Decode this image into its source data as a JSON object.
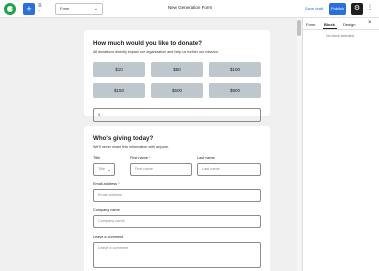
{
  "toolbar": {
    "add_symbol": "+",
    "form_select_value": "Form",
    "form_title": "New Generation Form",
    "save_draft": "Save draft",
    "publish": "Publish",
    "settings_symbol": "⚙",
    "more_symbol": "⋮"
  },
  "donate": {
    "title": "How much would you like to donate?",
    "subtitle": "All donations directly impact our organization and help us further our mission.",
    "amounts": [
      "$10",
      "$50",
      "$100",
      "$150",
      "$500",
      "$900"
    ],
    "custom_placeholder": "$"
  },
  "giver": {
    "title": "Who's giving today?",
    "subtitle": "We'll never share this information with anyone.",
    "title_label": "Title",
    "title_value": "Title",
    "first_name_label": "First name",
    "first_name_placeholder": "First name",
    "last_name_label": "Last name",
    "last_name_placeholder": "Last name",
    "email_label": "Email address",
    "email_placeholder": "Email address",
    "company_label": "Company name",
    "company_placeholder": "Company name",
    "comment_label": "Leave a comment",
    "comment_placeholder": "Leave a comment",
    "required_mark": "*"
  },
  "sidebar": {
    "tabs": [
      "Form",
      "Block",
      "Design"
    ],
    "active_tab": "Block",
    "close_symbol": "×",
    "empty_message": "No block selected."
  }
}
